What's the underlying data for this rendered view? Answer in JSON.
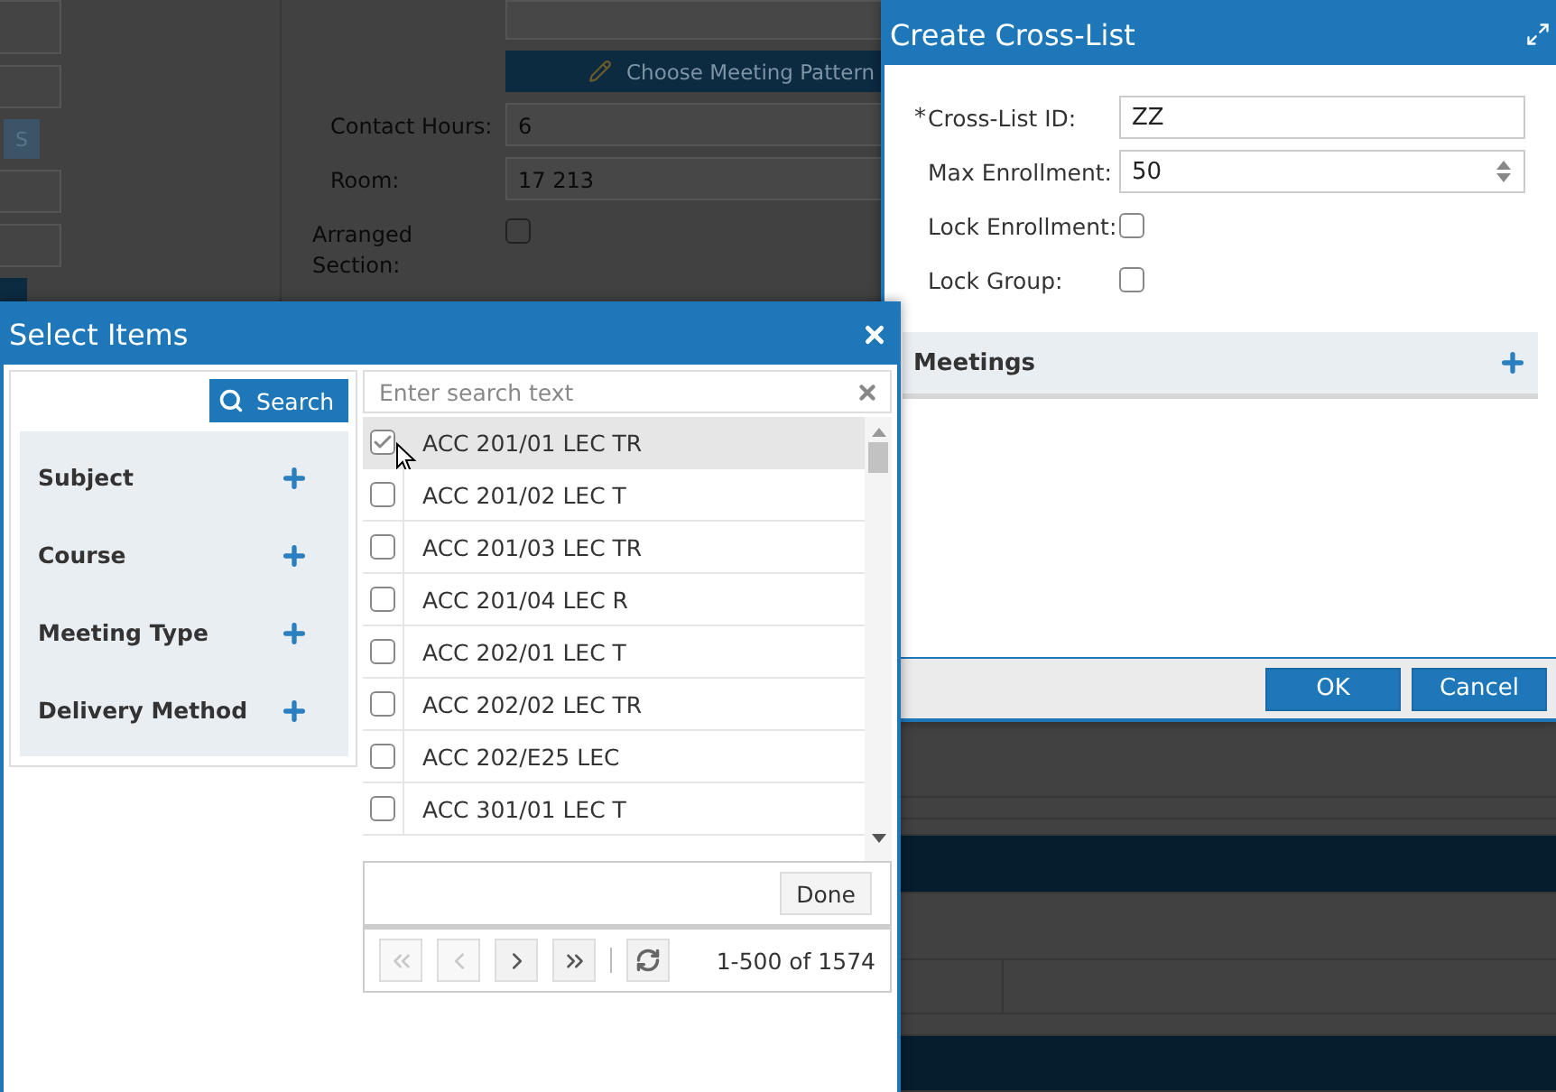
{
  "background_form": {
    "side_button": "S",
    "choose_button": "Choose Meeting Pattern",
    "fields": [
      {
        "label": "Contact Hours:",
        "value": "6"
      },
      {
        "label": "Room:",
        "value": "17 213"
      }
    ],
    "arranged_section": {
      "label": "Arranged Section:",
      "checked": false
    }
  },
  "cross_list_dialog": {
    "title": "Create Cross-List",
    "fields": [
      {
        "kind": "text",
        "label": "Cross-List ID:",
        "required_mark": "*",
        "value": "ZZ"
      },
      {
        "kind": "number",
        "label": "Max Enrollment:",
        "value": "50"
      },
      {
        "kind": "checkbox",
        "label": "Lock Enrollment:",
        "checked": false
      },
      {
        "kind": "checkbox",
        "label": "Lock Group:",
        "checked": false
      }
    ],
    "meetings": {
      "title": "Meetings"
    },
    "buttons": [
      "OK",
      "Cancel"
    ]
  },
  "select_dialog": {
    "title": "Select Items",
    "search_button": "Search",
    "filters": [
      {
        "label": "Subject"
      },
      {
        "label": "Course"
      },
      {
        "label": "Meeting Type"
      },
      {
        "label": "Delivery Method"
      }
    ],
    "search": {
      "placeholder": "Enter search text"
    },
    "rows": [
      {
        "label": "ACC 201/01 LEC TR",
        "checked": true,
        "highlighted": true
      },
      {
        "label": "ACC 201/02 LEC T",
        "checked": false,
        "highlighted": false
      },
      {
        "label": "ACC 201/03 LEC TR",
        "checked": false,
        "highlighted": false
      },
      {
        "label": "ACC 201/04 LEC R",
        "checked": false,
        "highlighted": false
      },
      {
        "label": "ACC 202/01 LEC T",
        "checked": false,
        "highlighted": false
      },
      {
        "label": "ACC 202/02 LEC TR",
        "checked": false,
        "highlighted": false
      },
      {
        "label": "ACC 202/E25 LEC",
        "checked": false,
        "highlighted": false
      },
      {
        "label": "ACC 301/01 LEC T",
        "checked": false,
        "highlighted": false
      }
    ],
    "done_button": "Done",
    "pager": {
      "buttons": [
        {
          "kind": "first",
          "disabled": true
        },
        {
          "kind": "previous",
          "disabled": true
        },
        {
          "kind": "next",
          "disabled": false
        },
        {
          "kind": "last",
          "disabled": false
        }
      ],
      "range": "1-500 of 1574"
    }
  }
}
